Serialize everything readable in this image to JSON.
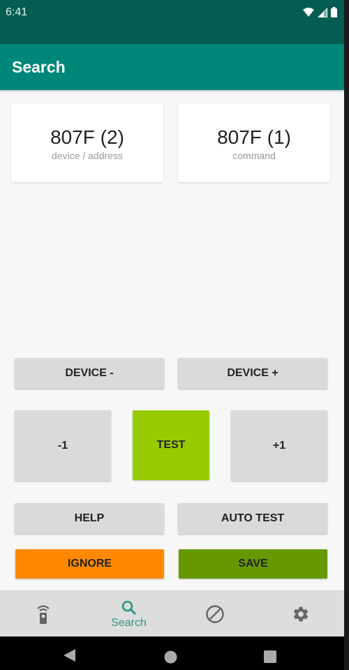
{
  "status_bar": {
    "time": "6:41",
    "icons": [
      "wifi-icon",
      "signal-icon",
      "battery-icon"
    ]
  },
  "app_bar": {
    "title": "Search"
  },
  "cards": [
    {
      "value": "807F (2)",
      "label": "device / address"
    },
    {
      "value": "807F (1)",
      "label": "command"
    }
  ],
  "buttons": {
    "device_minus": "DEVICE -",
    "device_plus": "DEVICE +",
    "minus_one": "-1",
    "test": "TEST",
    "plus_one": "+1",
    "help": "HELP",
    "auto_test": "AUTO TEST",
    "ignore": "IGNORE",
    "save": "SAVE"
  },
  "colors": {
    "status_bar": "#055d52",
    "app_bar": "#00877a",
    "test": "#99cc00",
    "ignore": "#ff8800",
    "save": "#669900",
    "nav_active": "#2e9586"
  },
  "bottom_nav": {
    "items": [
      {
        "icon": "remote-icon",
        "label": ""
      },
      {
        "icon": "search-icon",
        "label": "Search",
        "active": true
      },
      {
        "icon": "block-icon",
        "label": ""
      },
      {
        "icon": "gear-icon",
        "label": ""
      }
    ]
  },
  "system_nav": [
    "back-icon",
    "home-icon",
    "recents-icon"
  ]
}
